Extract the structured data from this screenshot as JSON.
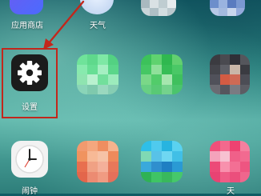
{
  "apps": {
    "app_store_label": "应用商店",
    "weather_label": "天气",
    "settings_label": "设置",
    "clock_label": "闹钟",
    "bottom_right_label": "天"
  },
  "annotation": {
    "highlight_color": "#c2271c"
  }
}
